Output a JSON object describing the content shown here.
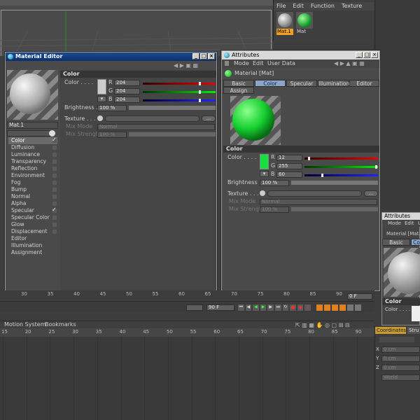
{
  "material_manager": {
    "menu": [
      "File",
      "Edit",
      "Function",
      "Texture"
    ],
    "materials": [
      {
        "name": "Mat.1",
        "selected": true,
        "color": "#cccccc"
      },
      {
        "name": "Mat",
        "selected": false,
        "color": "#22cc33"
      }
    ]
  },
  "material_editor": {
    "title": "Material Editor",
    "material_name": "Mat.1",
    "section": "Color",
    "color_label": "Color",
    "r": "204",
    "g": "204",
    "b": "204",
    "brightness_label": "Brightness",
    "brightness": "100 %",
    "texture_label": "Texture",
    "texture_button": "...",
    "mix_mode_label": "Mix Mode",
    "mix_mode": "Normal",
    "mix_strength_label": "Mix Strength",
    "mix_strength": "100 %",
    "channels": [
      {
        "label": "Color",
        "checked": true,
        "has_box": true
      },
      {
        "label": "Diffusion",
        "checked": false,
        "has_box": true
      },
      {
        "label": "Luminance",
        "checked": false,
        "has_box": true
      },
      {
        "label": "Transparency",
        "checked": false,
        "has_box": true
      },
      {
        "label": "Reflection",
        "checked": false,
        "has_box": true
      },
      {
        "label": "Environment",
        "checked": false,
        "has_box": true
      },
      {
        "label": "Fog",
        "checked": false,
        "has_box": true
      },
      {
        "label": "Bump",
        "checked": false,
        "has_box": true
      },
      {
        "label": "Normal",
        "checked": false,
        "has_box": true
      },
      {
        "label": "Alpha",
        "checked": false,
        "has_box": true
      },
      {
        "label": "Specular",
        "checked": true,
        "has_box": true
      },
      {
        "label": "Specular Color",
        "checked": false,
        "has_box": true
      },
      {
        "label": "Glow",
        "checked": false,
        "has_box": true
      },
      {
        "label": "Displacement",
        "checked": false,
        "has_box": true
      },
      {
        "label": "Editor",
        "checked": false,
        "has_box": false
      },
      {
        "label": "Illumination",
        "checked": false,
        "has_box": false
      },
      {
        "label": "Assignment",
        "checked": false,
        "has_box": false
      }
    ],
    "window_buttons": [
      "_",
      "□",
      "×"
    ]
  },
  "attributes": {
    "title": "Attributes",
    "menu": [
      "Mode",
      "Edit",
      "User Data"
    ],
    "object_label": "Material [Mat]",
    "tabs": [
      "Basic",
      "Color",
      "Specular",
      "Illumination",
      "Editor"
    ],
    "tab2": "Assign",
    "active_tab": "Color",
    "section": "Color",
    "color_label": "Color",
    "r": "12",
    "g": "255",
    "b": "60",
    "brightness_label": "Brightness",
    "brightness": "100 %",
    "texture_label": "Texture",
    "texture_button": "...",
    "mix_mode_label": "Mix Mode",
    "mix_mode": "Normal",
    "mix_strength_label": "Mix Strength",
    "mix_strength": "100 %",
    "window_buttons": [
      "_",
      "□",
      "×"
    ]
  },
  "channel_letters": {
    "r": "R",
    "g": "G",
    "b": "B"
  },
  "ruler_ticks": [
    "30",
    "35",
    "40",
    "45",
    "50",
    "55",
    "60",
    "65",
    "70",
    "75",
    "80",
    "85",
    "90"
  ],
  "transport": {
    "frame_end": "90 F",
    "current_frame": "0 F"
  },
  "timeline_menu": [
    "Motion System",
    "Bookmarks"
  ],
  "timeline_ticks": [
    "15",
    "20",
    "25",
    "30",
    "35",
    "40",
    "45",
    "50",
    "55",
    "60",
    "65",
    "70",
    "75",
    "80",
    "85",
    "90"
  ],
  "right_attr": {
    "title": "Attributes",
    "menu": [
      "Mode",
      "Edit",
      "U"
    ],
    "object_label": "Material [Mat.",
    "tab": "Basic",
    "tab_active": "Co",
    "section": "Color",
    "color_label": "Color"
  },
  "coordinates": {
    "tab": "Coordinates",
    "tab2": "Stru",
    "x_label": "X",
    "x": "0 cm",
    "y_label": "Y",
    "y": "0 cm",
    "z_label": "Z",
    "z": "0 cm",
    "mode": "World"
  },
  "colors": {
    "green": "#16e040",
    "blue_title": "#0a2f6f"
  }
}
